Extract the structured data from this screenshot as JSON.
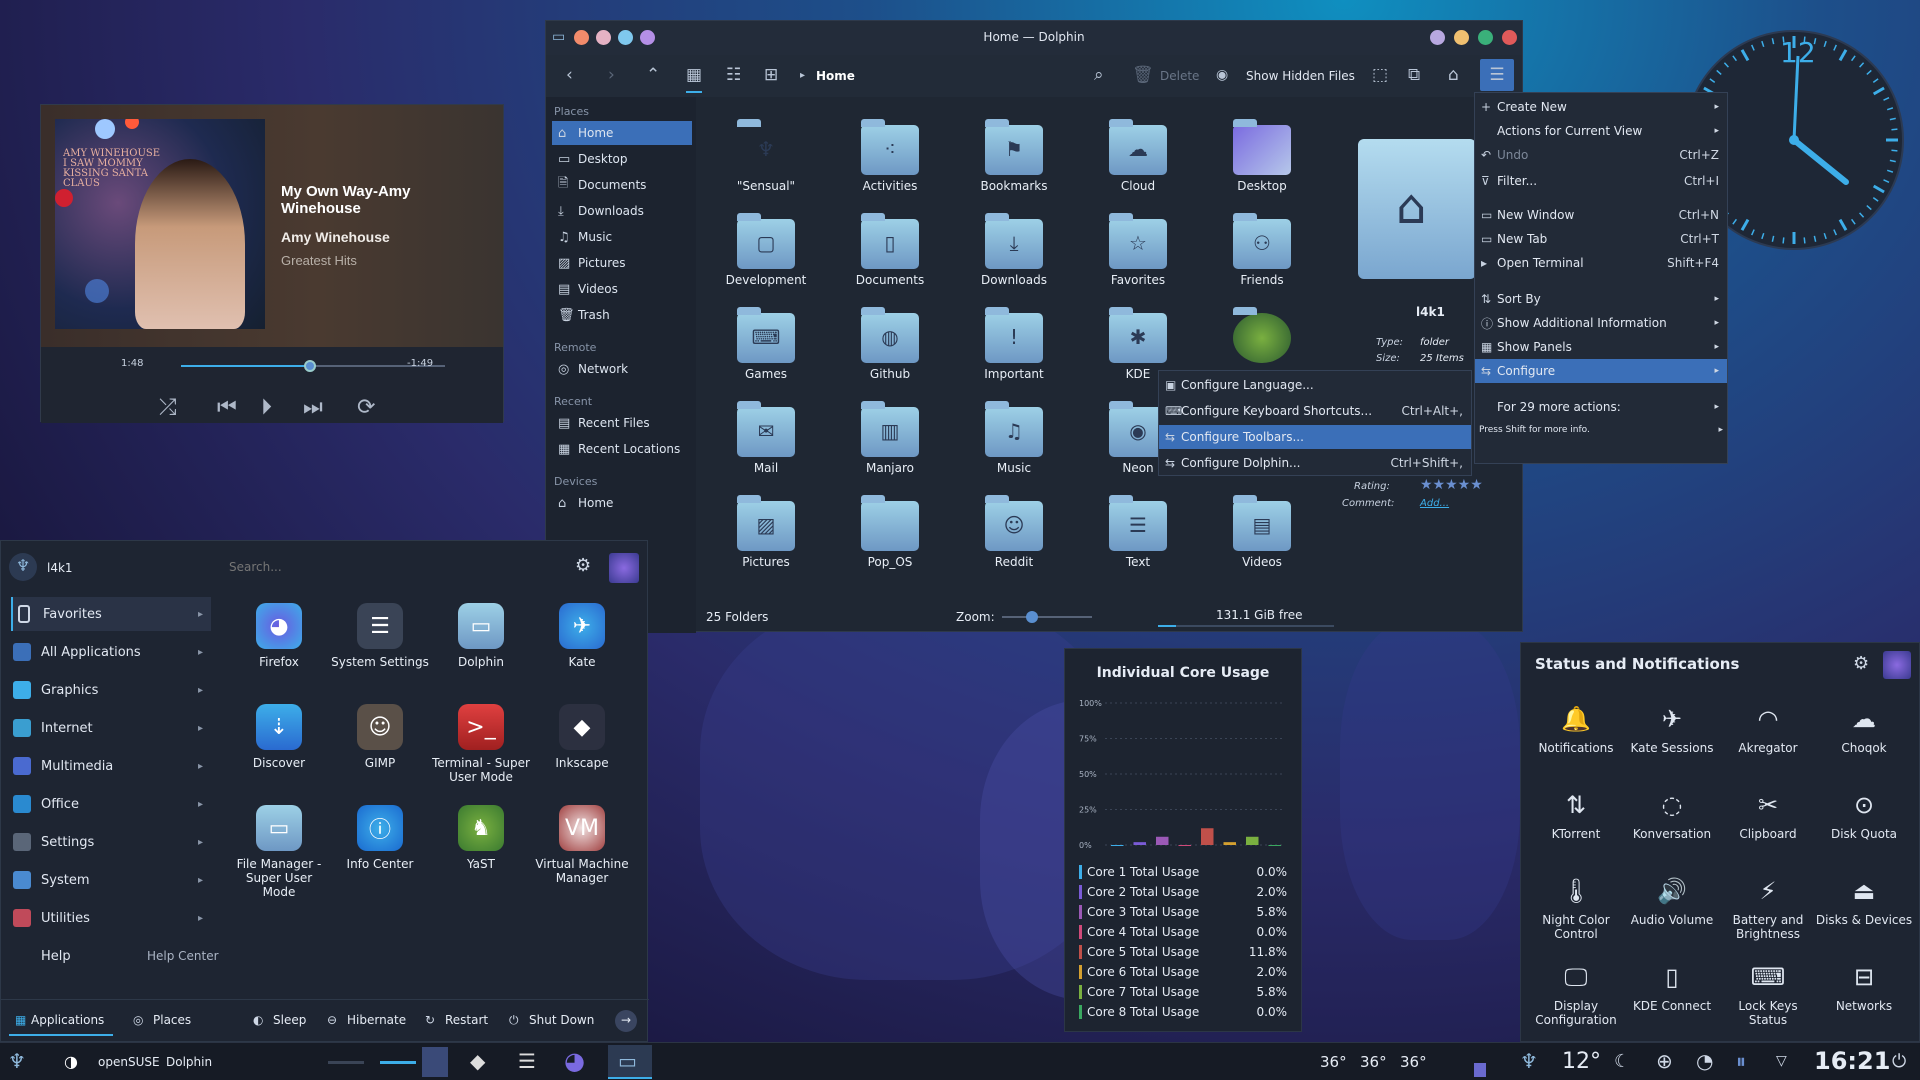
{
  "player": {
    "title": "My Own Way-Amy Winehouse",
    "artist": "Amy Winehouse",
    "album": "Greatest Hits",
    "album_art_text": "AMY WINEHOUSE I SAW MOMMY KISSING SANTA CLAUS",
    "elapsed": "1:48",
    "remaining": "-1:49",
    "progress": 0.49
  },
  "dolphin": {
    "title": "Home — Dolphin",
    "breadcrumb": "Home",
    "delete": "Delete",
    "show_hidden": "Show Hidden Files",
    "places": {
      "places_header": "Places",
      "remote_header": "Remote",
      "recent_header": "Recent",
      "devices_header": "Devices",
      "items": [
        "Home",
        "Desktop",
        "Documents",
        "Downloads",
        "Music",
        "Pictures",
        "Videos",
        "Trash"
      ],
      "remote": [
        "Network"
      ],
      "recent": [
        "Recent Files",
        "Recent Locations"
      ],
      "devices": [
        "Home"
      ]
    },
    "folders": [
      "\"Sensual\"",
      "Activities",
      "Bookmarks",
      "Cloud",
      "Desktop",
      "Development",
      "Documents",
      "Downloads",
      "Favorites",
      "Friends",
      "Games",
      "Github",
      "Important",
      "KDE",
      "",
      "Mail",
      "Manjaro",
      "Music",
      "Neon",
      "",
      "Pictures",
      "Pop_OS",
      "Reddit",
      "Text",
      "Videos"
    ],
    "info": {
      "name": "l4k1",
      "type_label": "Type:",
      "type": "folder",
      "size_label": "Size:",
      "size": "25 Items",
      "rating_label": "Rating:",
      "comment_label": "Comment:",
      "comment": "Add..."
    },
    "status": {
      "folders": "25 Folders",
      "zoom": "Zoom:",
      "free": "131.1 GiB free"
    }
  },
  "hamburger_menu": [
    {
      "label": "Create New",
      "sc": "",
      "sub": true
    },
    {
      "label": "Actions for Current View",
      "sc": "",
      "sub": true
    },
    {
      "label": "Undo",
      "sc": "Ctrl+Z",
      "dis": true
    },
    {
      "label": "Filter...",
      "sc": "Ctrl+I"
    },
    {
      "label": "New Window",
      "sc": "Ctrl+N"
    },
    {
      "label": "New Tab",
      "sc": "Ctrl+T"
    },
    {
      "label": "Open Terminal",
      "sc": "Shift+F4"
    },
    {
      "label": "Sort By",
      "sc": "",
      "sub": true
    },
    {
      "label": "Show Additional Information",
      "sc": "",
      "sub": true
    },
    {
      "label": "Show Panels",
      "sc": "",
      "sub": true
    },
    {
      "label": "Configure",
      "sc": "",
      "sub": true,
      "hl": true
    },
    {
      "label": "For 29 more actions:",
      "sc": "",
      "sub": true
    },
    {
      "label": "Press Shift for more info.",
      "sc": "",
      "sub": true
    }
  ],
  "configure_menu": [
    {
      "label": "Configure Language...",
      "sc": ""
    },
    {
      "label": "Configure Keyboard Shortcuts...",
      "sc": "Ctrl+Alt+,"
    },
    {
      "label": "Configure Toolbars...",
      "sc": "",
      "hl": true
    },
    {
      "label": "Configure Dolphin...",
      "sc": "Ctrl+Shift+,"
    }
  ],
  "start": {
    "user": "l4k1",
    "search": "Search...",
    "categories": [
      "Favorites",
      "All Applications",
      "Graphics",
      "Internet",
      "Multimedia",
      "Office",
      "Settings",
      "System",
      "Utilities",
      "Help"
    ],
    "help_center": "Help Center",
    "apps": [
      "Firefox",
      "System Settings",
      "Dolphin",
      "Kate",
      "Discover",
      "GIMP",
      "Terminal - Super User Mode",
      "Inkscape",
      "File Manager - Super User Mode",
      "Info Center",
      "YaST",
      "Virtual Machine Manager"
    ],
    "tabs": [
      "Applications",
      "Places"
    ],
    "power": [
      "Sleep",
      "Hibernate",
      "Restart",
      "Shut Down"
    ]
  },
  "cpu": {
    "title": "Individual Core Usage",
    "ticks": [
      "100%",
      "75%",
      "50%",
      "25%",
      "0%"
    ],
    "cores": [
      {
        "name": "Core 1 Total Usage",
        "v": "0.0%",
        "n": 0,
        "c": "#3daee9"
      },
      {
        "name": "Core 2 Total Usage",
        "v": "2.0%",
        "n": 2,
        "c": "#7a5bd6"
      },
      {
        "name": "Core 3 Total Usage",
        "v": "5.8%",
        "n": 5.8,
        "c": "#9b59b6"
      },
      {
        "name": "Core 4 Total Usage",
        "v": "0.0%",
        "n": 0,
        "c": "#d04a7a"
      },
      {
        "name": "Core 5 Total Usage",
        "v": "11.8%",
        "n": 11.8,
        "c": "#c0504a"
      },
      {
        "name": "Core 6 Total Usage",
        "v": "2.0%",
        "n": 2,
        "c": "#d4a030"
      },
      {
        "name": "Core 7 Total Usage",
        "v": "5.8%",
        "n": 5.8,
        "c": "#7ab040"
      },
      {
        "name": "Core 8 Total Usage",
        "v": "0.0%",
        "n": 0,
        "c": "#3aa860"
      }
    ]
  },
  "tray": {
    "title": "Status and Notifications",
    "items": [
      "Notifications",
      "Kate Sessions",
      "Akregator",
      "Choqok",
      "KTorrent",
      "Konversation",
      "Clipboard",
      "Disk Quota",
      "Night Color Control",
      "Audio Volume",
      "Battery and Brightness",
      "Disks & Devices",
      "Display Configuration",
      "KDE Connect",
      "Lock Keys Status",
      "Networks"
    ]
  },
  "taskbar": {
    "distro": "openSUSE",
    "app": "Dolphin",
    "temps": [
      "36°",
      "36°",
      "36°"
    ],
    "weather": "12°",
    "time": "16:21"
  },
  "clock": {
    "hour_label": "12"
  }
}
